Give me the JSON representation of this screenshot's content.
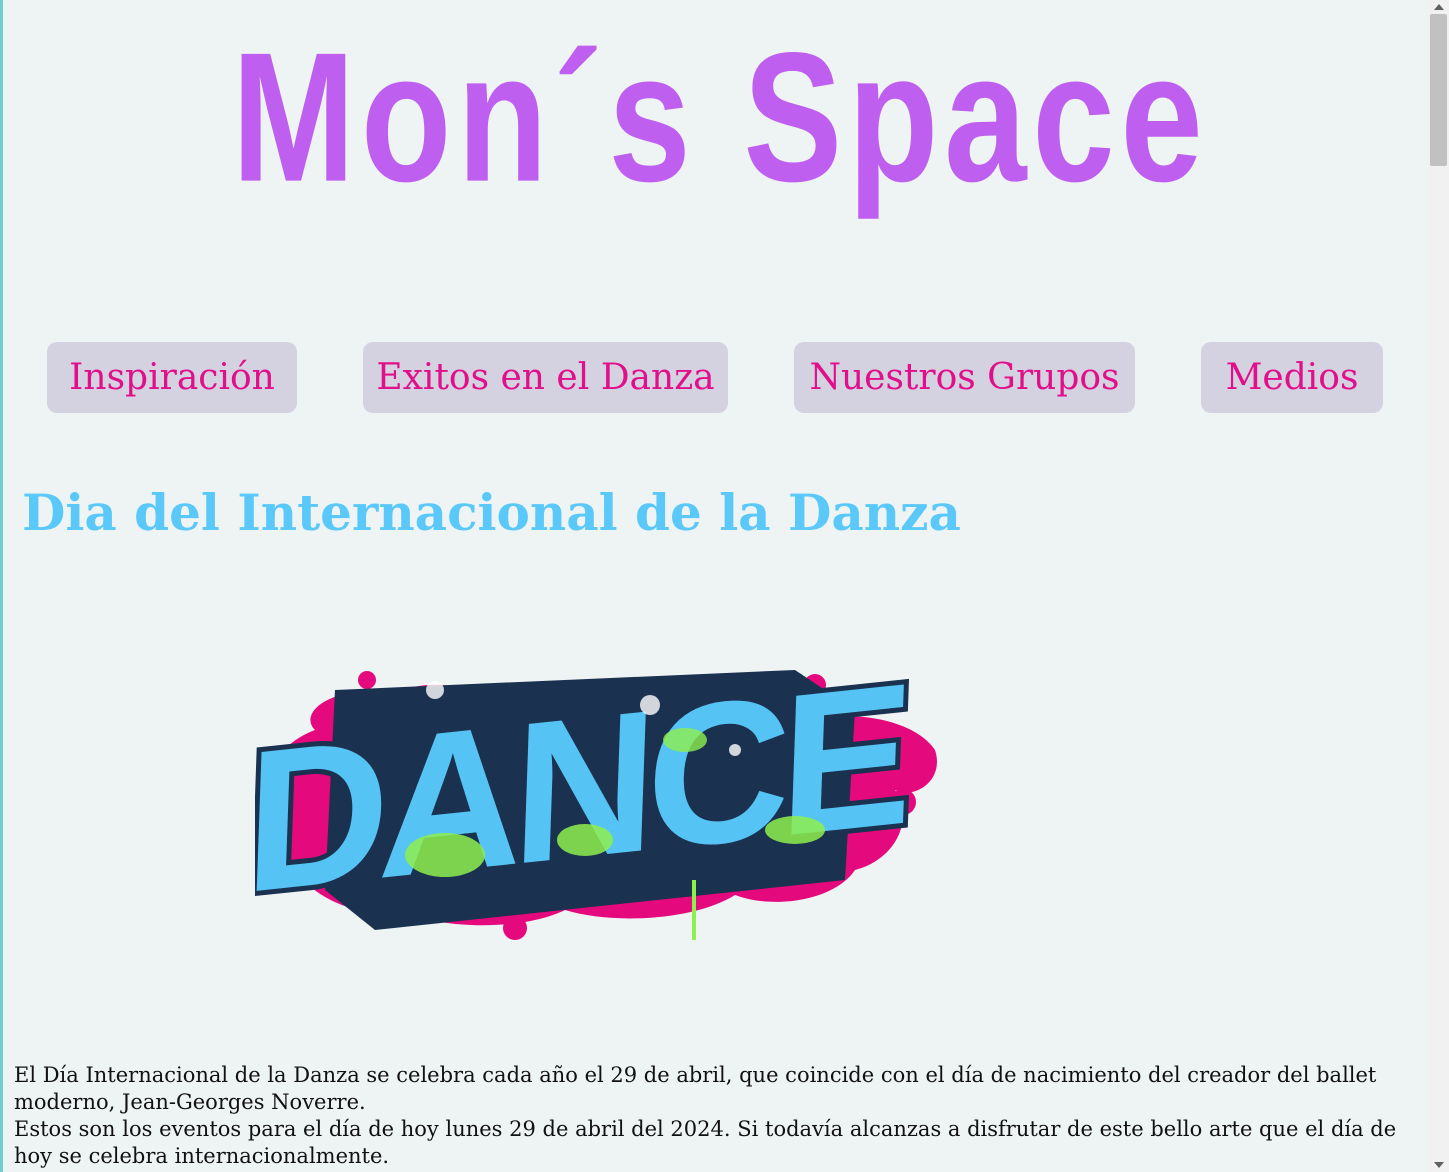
{
  "header": {
    "logo_text": "Mon´s Space"
  },
  "nav": {
    "items": [
      {
        "label": "Inspiración"
      },
      {
        "label": "Exitos en el Danza"
      },
      {
        "label": "Nuestros Grupos"
      },
      {
        "label": "Medios"
      }
    ]
  },
  "main": {
    "title": "Dia del Internacional de la Danza",
    "image_text": "DANCE",
    "paragraphs": [
      "El Día Internacional de la Danza se celebra cada año el 29 de abril, que coincide con el día de nacimiento del creador del ballet moderno, Jean-Georges Noverre.",
      "Estos son los eventos para el día de hoy lunes 29 de abril del 2024. Si todavía alcanzas a disfrutar de este bello arte que el día de hoy se celebra internacionalmente."
    ]
  },
  "colors": {
    "background": "#eef3f3",
    "logo": "#bf5fef",
    "nav_button_bg": "#d4d1e1",
    "nav_text": "#e20f8a",
    "title": "#5bc8fa",
    "graffiti_pink": "#e4097d",
    "graffiti_blue": "#55c3f3",
    "graffiti_green": "#8ef04e",
    "graffiti_outline": "#1b3150"
  }
}
